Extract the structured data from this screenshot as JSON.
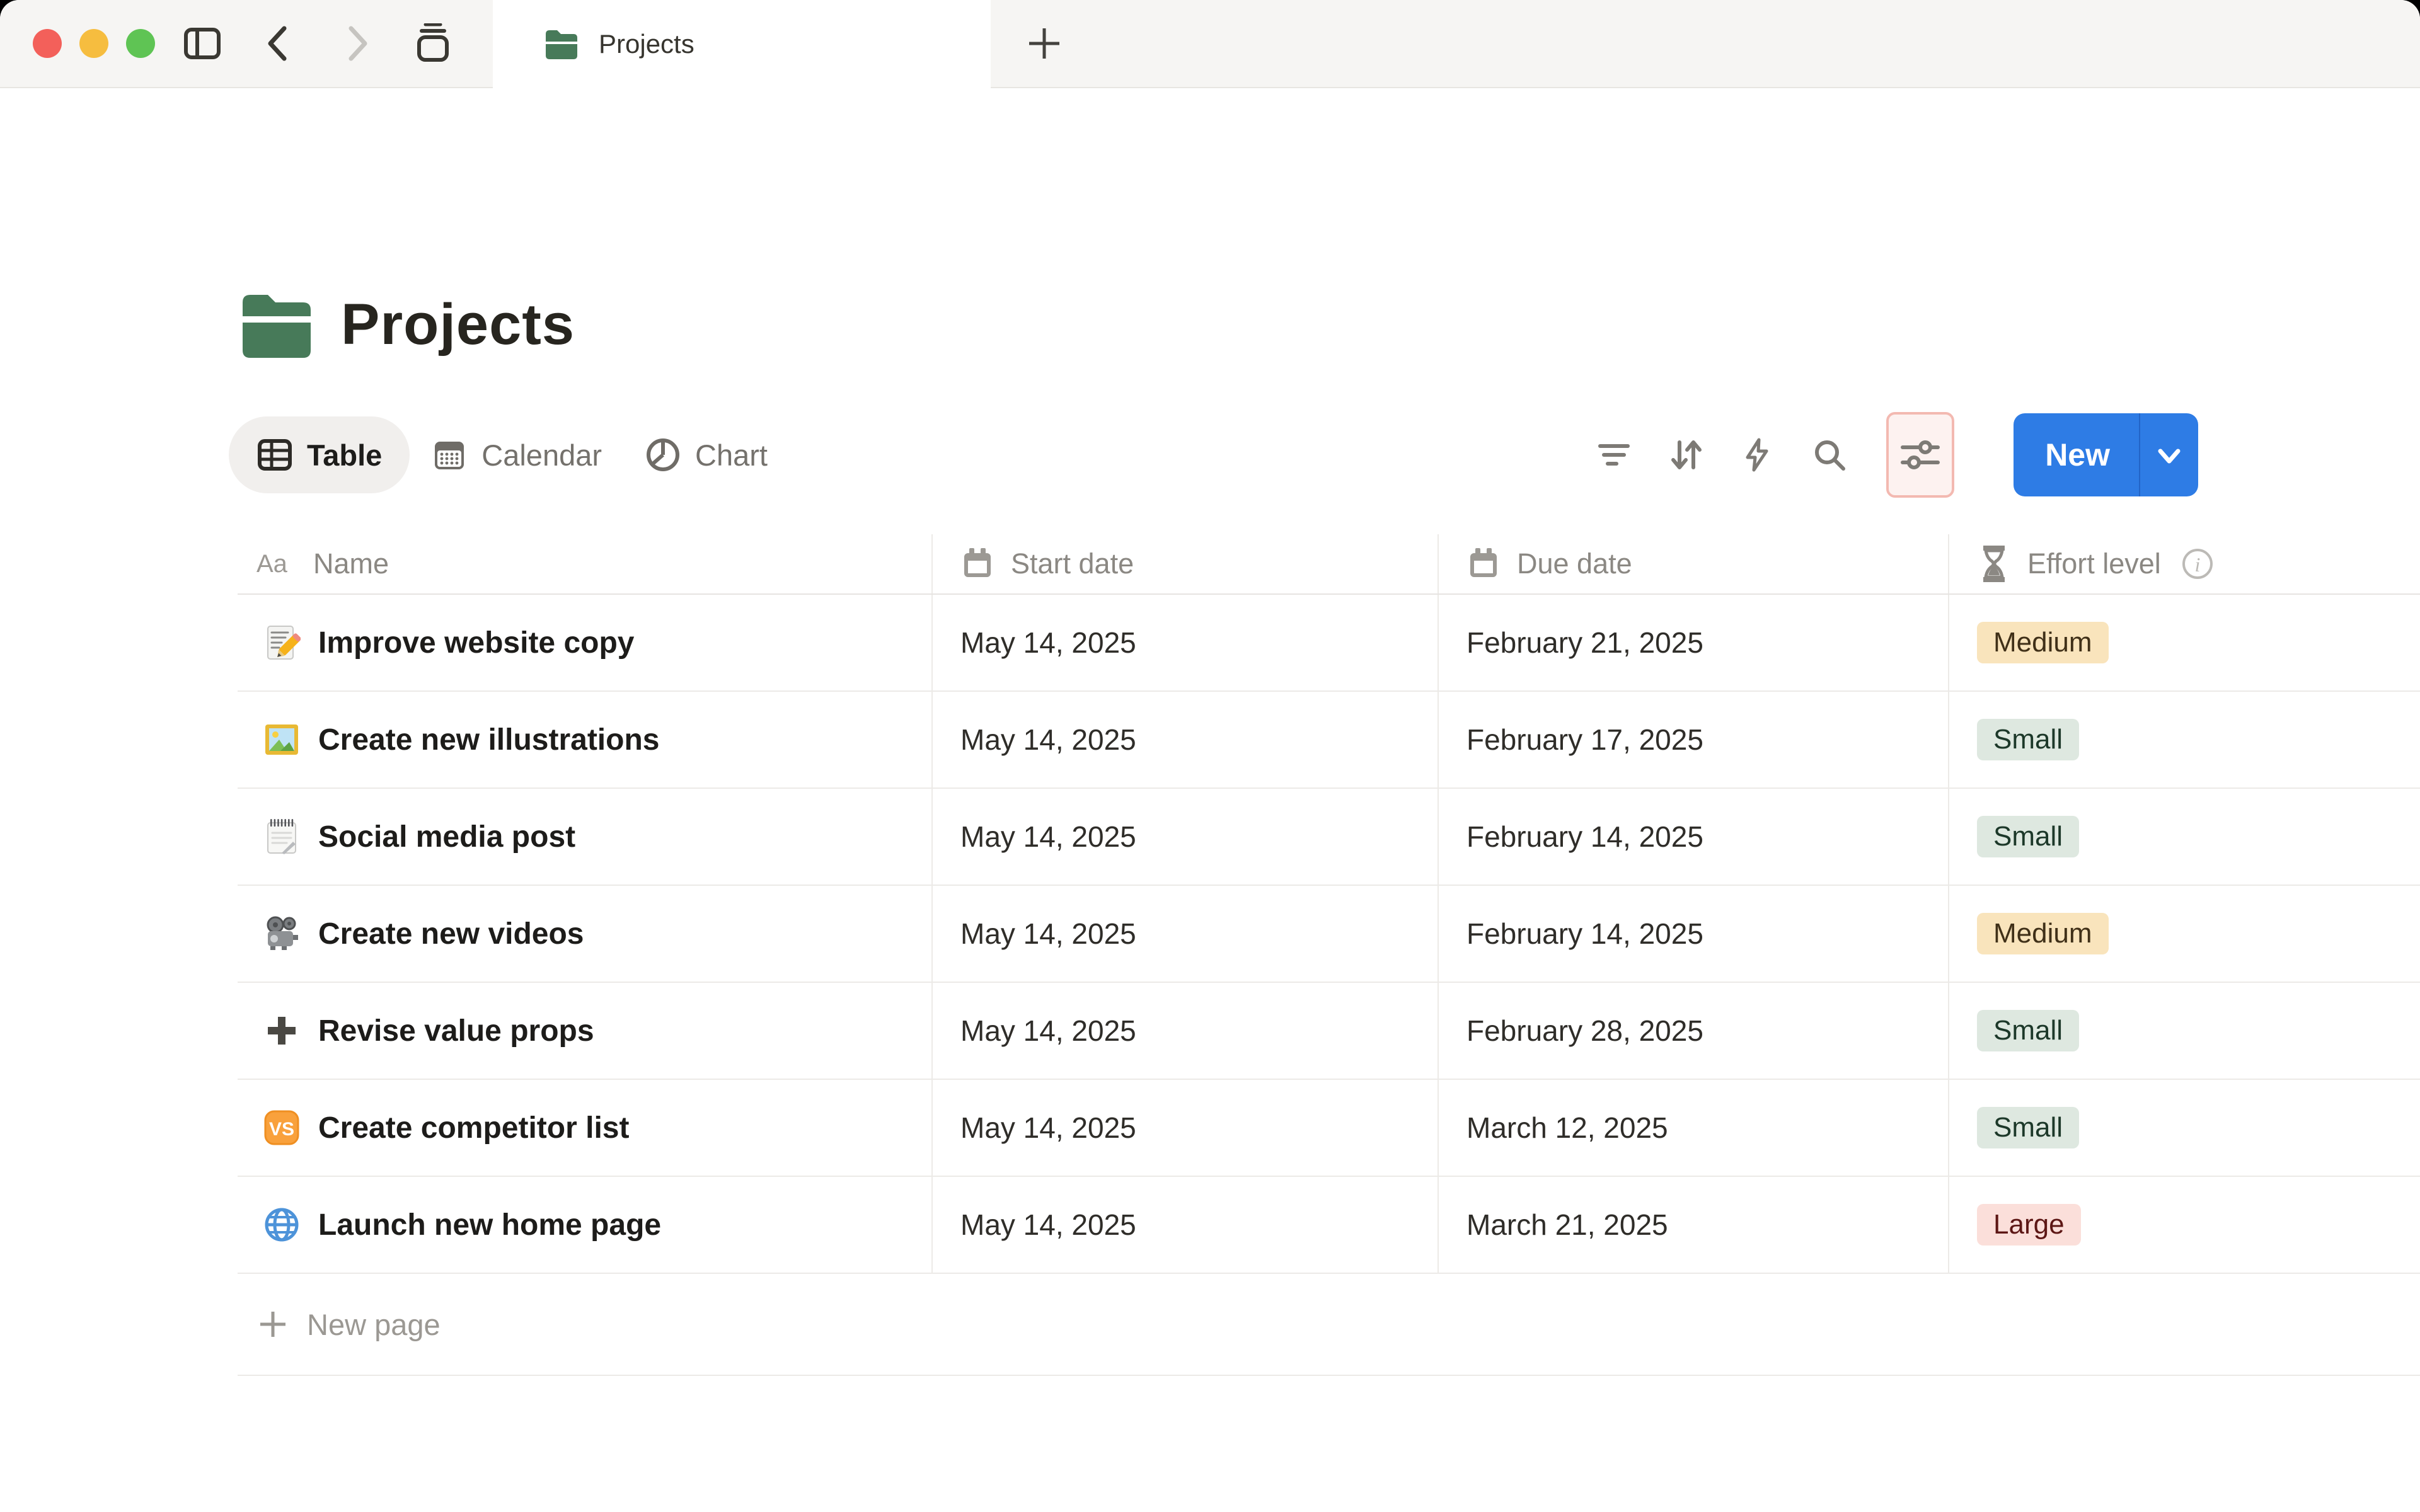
{
  "window": {
    "traffic_lights": [
      "close",
      "minimize",
      "zoom"
    ],
    "nav_icons": [
      "sidebar-toggle",
      "back",
      "forward",
      "tab-overview"
    ],
    "tab": {
      "icon": "folder",
      "title": "Projects"
    },
    "new_tab_icon": "plus"
  },
  "page": {
    "icon": "folder",
    "title": "Projects",
    "views": [
      {
        "label": "Table",
        "icon": "table-grid",
        "active": true
      },
      {
        "label": "Calendar",
        "icon": "calendar-solid",
        "active": false
      },
      {
        "label": "Chart",
        "icon": "pie-chart",
        "active": false
      }
    ],
    "toolbar": {
      "icons": [
        "filter",
        "sort",
        "lightning",
        "search"
      ],
      "sliders_highlighted": true,
      "new_button_label": "New"
    },
    "table": {
      "columns": [
        {
          "label": "Name",
          "icon": "text-aa"
        },
        {
          "label": "Start date",
          "icon": "calendar"
        },
        {
          "label": "Due date",
          "icon": "calendar"
        },
        {
          "label": "Effort level",
          "icon": "hourglass",
          "info_icon": true
        }
      ],
      "rows": [
        {
          "icon": "memo",
          "name": "Improve website copy",
          "start": "May 14, 2025",
          "due": "February 21, 2025",
          "effort": "Medium"
        },
        {
          "icon": "framed-picture",
          "name": "Create new illustrations",
          "start": "May 14, 2025",
          "due": "February 17, 2025",
          "effort": "Small"
        },
        {
          "icon": "spiral-notepad",
          "name": "Social media post",
          "start": "May 14, 2025",
          "due": "February 14, 2025",
          "effort": "Small"
        },
        {
          "icon": "film-projector",
          "name": "Create new videos",
          "start": "May 14, 2025",
          "due": "February 14, 2025",
          "effort": "Medium"
        },
        {
          "icon": "heavy-plus",
          "name": "Revise value props",
          "start": "May 14, 2025",
          "due": "February 28, 2025",
          "effort": "Small"
        },
        {
          "icon": "vs-badge",
          "name": "Create competitor list",
          "start": "May 14, 2025",
          "due": "March 12, 2025",
          "effort": "Small"
        },
        {
          "icon": "globe",
          "name": "Launch new home page",
          "start": "May 14, 2025",
          "due": "March 21, 2025",
          "effort": "Large"
        }
      ],
      "new_page_label": "New page"
    },
    "effort_colors": {
      "Medium": {
        "bg": "#f9e4bc",
        "text": "#403018"
      },
      "Small": {
        "bg": "#dee8e0",
        "text": "#1c3829"
      },
      "Large": {
        "bg": "#fbdfda",
        "text": "#5d1715"
      }
    },
    "accent_colors": {
      "new_button_blue": "#2e7ce5",
      "highlight_border": "#f3b9b1",
      "highlight_bg": "#fdf2f0",
      "folder_green": "#477a59"
    }
  }
}
